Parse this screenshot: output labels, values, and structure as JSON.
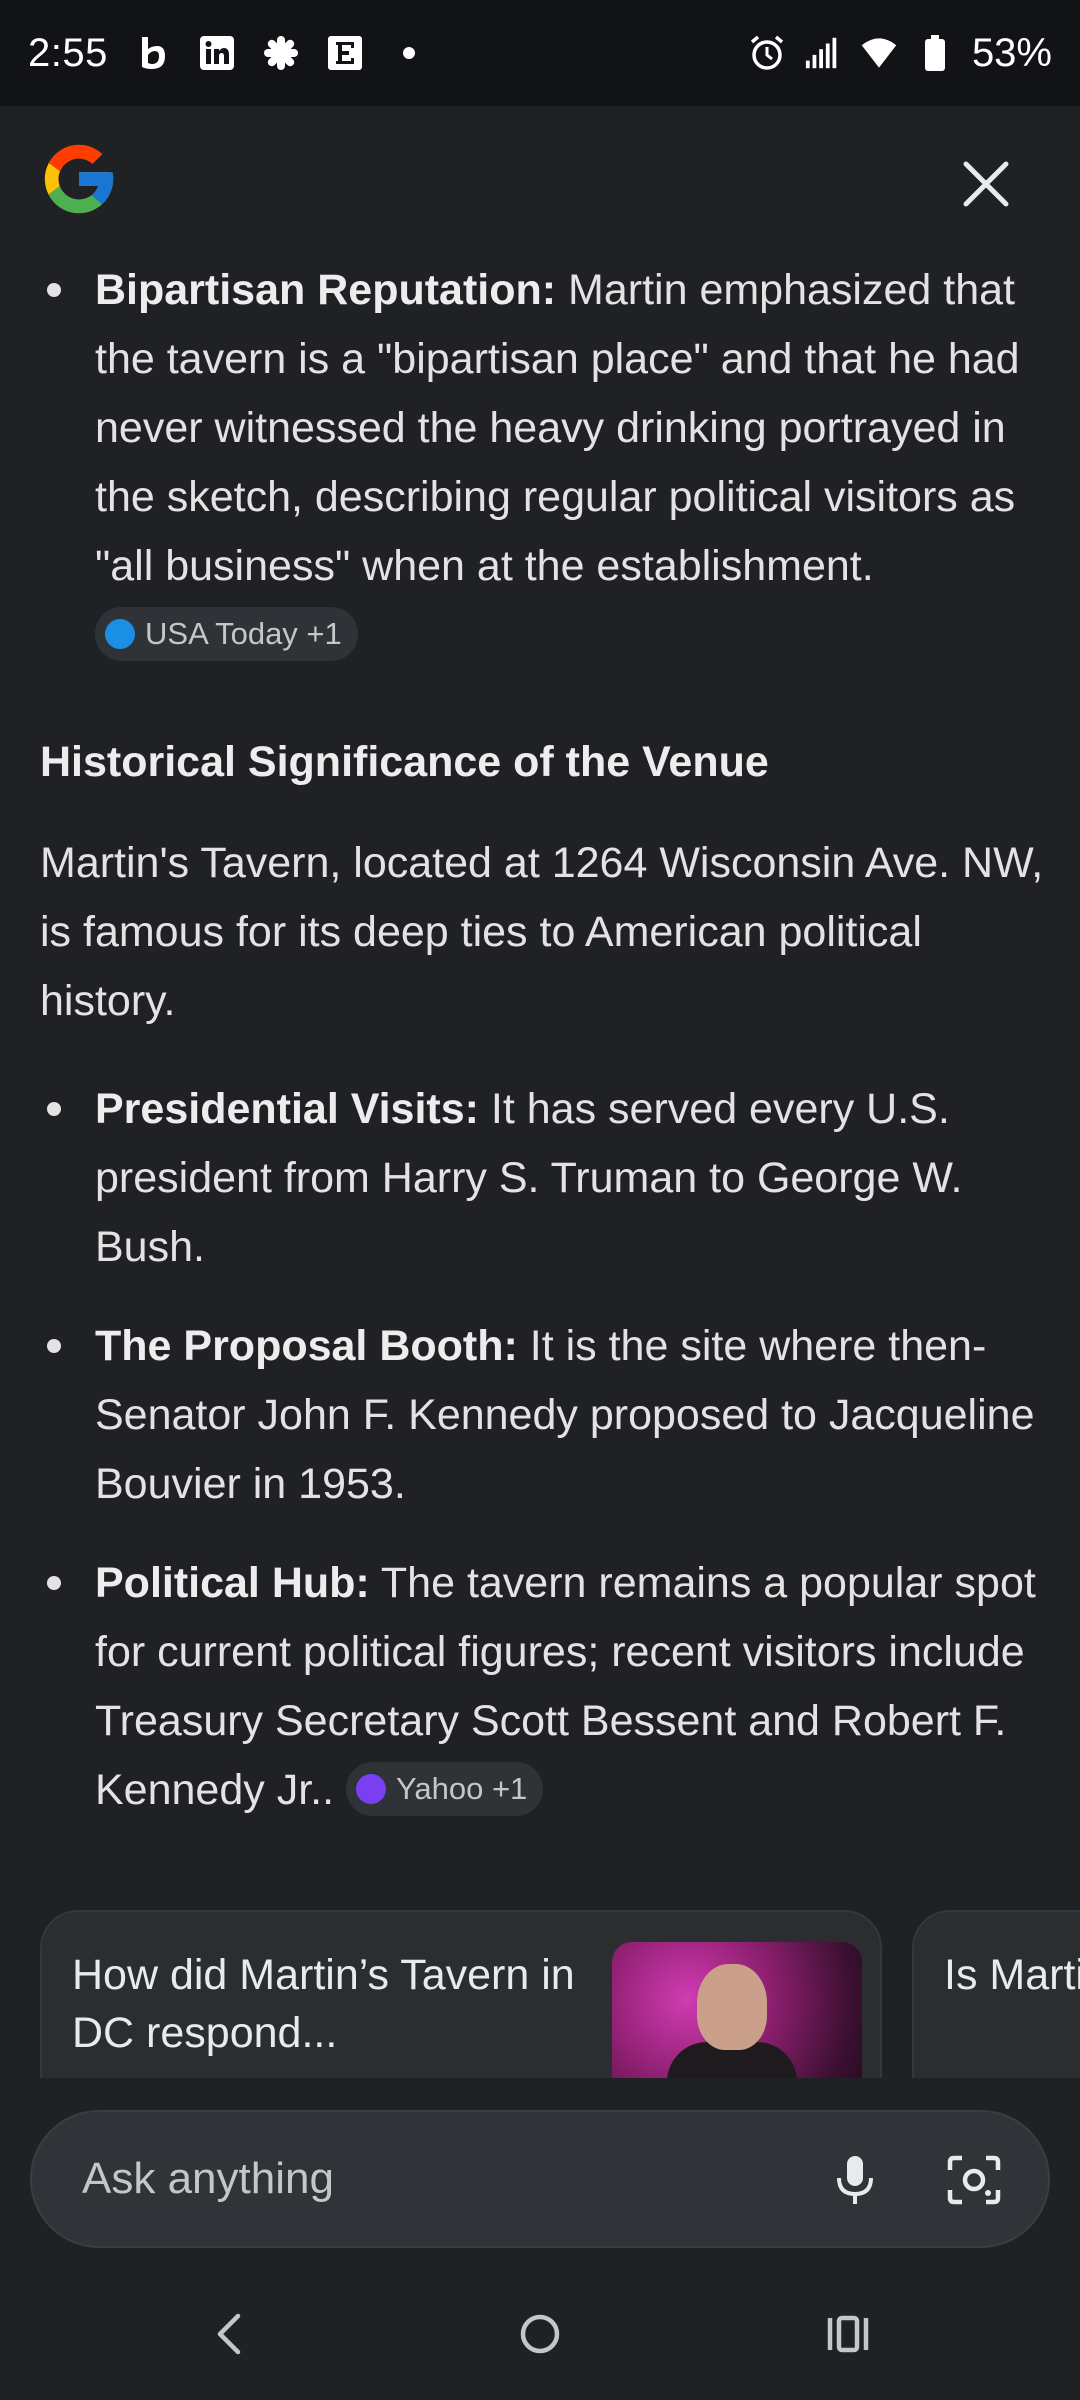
{
  "status_bar": {
    "time": "2:55",
    "battery": "53%",
    "notification_icons": [
      "b-app-icon",
      "linkedin-icon",
      "slack-icon",
      "e-app-icon",
      "dot-icon"
    ]
  },
  "bullets_top": [
    {
      "title": "Bipartisan Reputation:",
      "text": " Martin emphasized that the tavern is a \"bipartisan place\" and that he had never witnessed the heavy drinking portrayed in the sketch, describing regular political visitors as \"all business\" when at the establishment. ",
      "source": "USA Today +1"
    }
  ],
  "section": {
    "heading": "Historical Significance of the Venue",
    "intro": "Martin's Tavern, located at 1264 Wisconsin Ave. NW, is famous for its deep ties to American political history."
  },
  "bullets": [
    {
      "title": "Presidential Visits:",
      "text": " It has served every U.S. president from Harry S. Truman to George W. Bush."
    },
    {
      "title": "The Proposal Booth:",
      "text": " It is the site where then-Senator John F. Kennedy proposed to Jacqueline Bouvier in 1953."
    },
    {
      "title": "Political Hub:",
      "text": " The tavern remains a popular spot for current political figures; recent visitors include Treasury Secretary Scott Bessent and Robert F. Kennedy Jr.. ",
      "source": "Yahoo +1"
    }
  ],
  "cards": [
    {
      "title": "How did Martin’s Tavern in DC respond..."
    },
    {
      "title": "Is Martin’s Tavern 'SNL' s..."
    }
  ],
  "search": {
    "placeholder": "Ask anything"
  },
  "colors": {
    "background": "#1f2125",
    "status_bar": "#111316",
    "chip": "#2f3236",
    "card": "#2b2d31"
  }
}
